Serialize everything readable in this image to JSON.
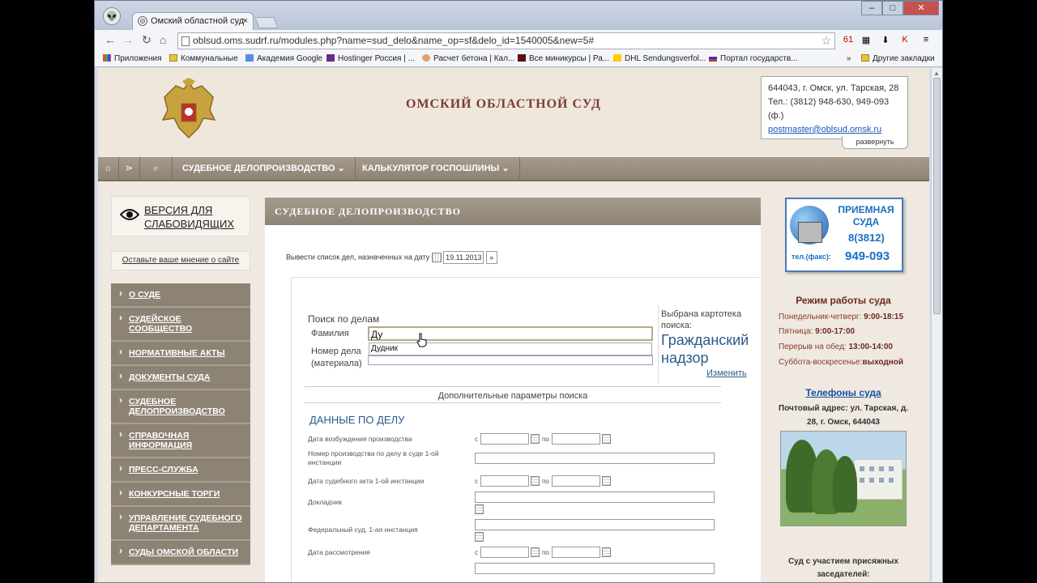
{
  "browser": {
    "tab_title": "Омский областной суд",
    "tab_close": "×",
    "url": "oblsud.oms.sudrf.ru/modules.php?name=sud_delo&name_op=sf&delo_id=1540005&new=5#",
    "bookmarks": [
      "Приложения",
      "Коммунальные",
      "Академия Google",
      "Hostinger Россия | ...",
      "Расчет бетона | Кал...",
      "Все миникурсы | Ра...",
      "DHL Sendungsverfol...",
      "Портал государств..."
    ],
    "bookmarks_more": "»",
    "other_bookmarks": "Другие закладки",
    "ext_badge": "61"
  },
  "header": {
    "court_name": "ОМСКИЙ ОБЛАСТНОЙ СУД",
    "address": "644043, г. Омск, ул. Тарская, 28",
    "phone": "Тел.: (3812) 948-630, 949-093 (ф.)",
    "email": "postmaster@oblsud.omsk.ru",
    "expand": "развернуть"
  },
  "nav": {
    "items": [
      "СУДЕБНОЕ ДЕЛОПРОИЗВОДСТВО ⌄",
      "КАЛЬКУЛЯТОР ГОСПОШЛИНЫ ⌄"
    ]
  },
  "sidebar": {
    "low_vision": "ВЕРСИЯ ДЛЯ СЛАБОВИДЯЩИХ",
    "feedback": "Оставьте ваше мнение о сайте",
    "items": [
      "О СУДЕ",
      "СУДЕЙСКОЕ СООБЩЕСТВО",
      "НОРМАТИВНЫЕ АКТЫ",
      "ДОКУМЕНТЫ СУДА",
      "СУДЕБНОЕ ДЕЛОПРОИЗВОДСТВО",
      "СПРАВОЧНАЯ ИНФОРМАЦИЯ",
      "ПРЕСС-СЛУЖБА",
      "КОНКУРСНЫЕ ТОРГИ",
      "УПРАВЛЕНИЕ СУДЕБНОГО ДЕПАРТАМЕНТА",
      "СУДЫ ОМСКОЙ ОБЛАСТИ"
    ]
  },
  "main": {
    "section_title": "СУДЕБНОЕ ДЕЛОПРОИЗВОДСТВО",
    "date_label": "Вывести список дел, назначенных на дату",
    "date_value": "19.11.2013",
    "search_title": "Поиск по делам",
    "surname_label": "Фамилия",
    "surname_value": "Ду",
    "suggestion": "Дудник",
    "case_number_label": "Номер дела (материала)",
    "selected_label": "Выбрана картотека поиска:",
    "selected_value": "Гражданский надзор",
    "change": "Изменить",
    "extra_params": "Дополнительные параметры поиска",
    "case_data_title": "ДАННЫЕ ПО ДЕЛУ",
    "from": "с",
    "to": "по",
    "fields": [
      "Дата возбуждения производства",
      "Номер производства по делу в суде 1-ой инстанции",
      "Дата судебного акта 1-ой инстанции",
      "Докладчик",
      "Федеральный суд, 1-ая инстанция",
      "Дата рассмотрения"
    ]
  },
  "right": {
    "priemnaya_title": "ПРИЕМНАЯ СУДА",
    "priemnaya_code": "8(3812)",
    "priemnaya_fax": "тел.(факс):",
    "priemnaya_number": "949-093",
    "hours_title": "Режим работы суда",
    "hours": [
      {
        "label": "Понедельник-четверг: ",
        "value": "9:00-18:15"
      },
      {
        "label": "Пятница: ",
        "value": "9:00-17:00"
      },
      {
        "label": "Перерыв на обед: ",
        "value": "13:00-14:00"
      },
      {
        "label": "Суббота-воскресенье:",
        "value": "выходной"
      }
    ],
    "phones_link": "Телефоны суда",
    "postal_address": "Почтовый адрес: ул. Тарская, д. 28, г. Омск, 644043",
    "bottom_text": "Суд с участием присяжных заседателей:"
  },
  "colors": {
    "nav_bg": "#8d8374",
    "title_red": "#7a3c32",
    "link_blue": "#1a56b5"
  }
}
